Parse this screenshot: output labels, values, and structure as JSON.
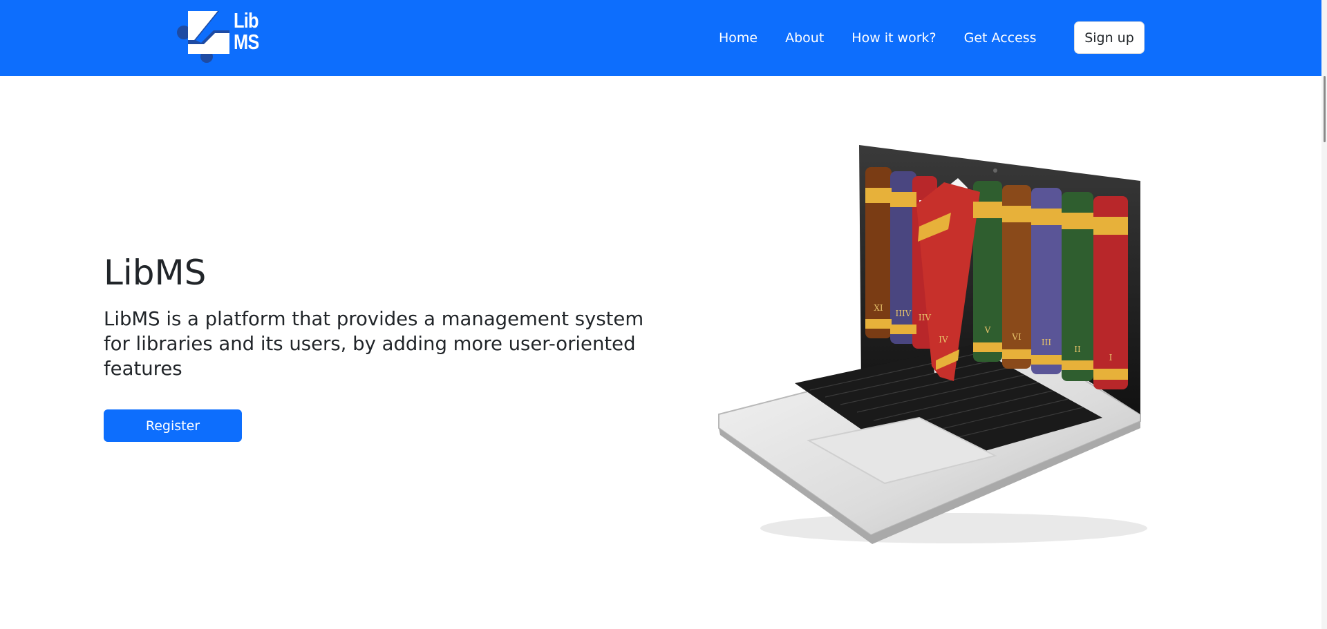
{
  "brand": {
    "line1": "Lib",
    "line2": "MS"
  },
  "nav": {
    "links": [
      {
        "label": "Home"
      },
      {
        "label": "About"
      },
      {
        "label": "How it work?"
      },
      {
        "label": "Get Access"
      }
    ],
    "signup_label": "Sign up"
  },
  "hero": {
    "title": "LibMS",
    "description": "LibMS is a platform that provides a management system for libraries and its users, by adding more user-oriented features",
    "register_label": "Register"
  },
  "illustration": {
    "book_numerals": [
      "XI",
      "IIIV",
      "IIV",
      "IV",
      "V",
      "VI",
      "III",
      "II",
      "I"
    ]
  },
  "colors": {
    "primary": "#0d6efd",
    "logo_dark": "#1e4ba3"
  }
}
